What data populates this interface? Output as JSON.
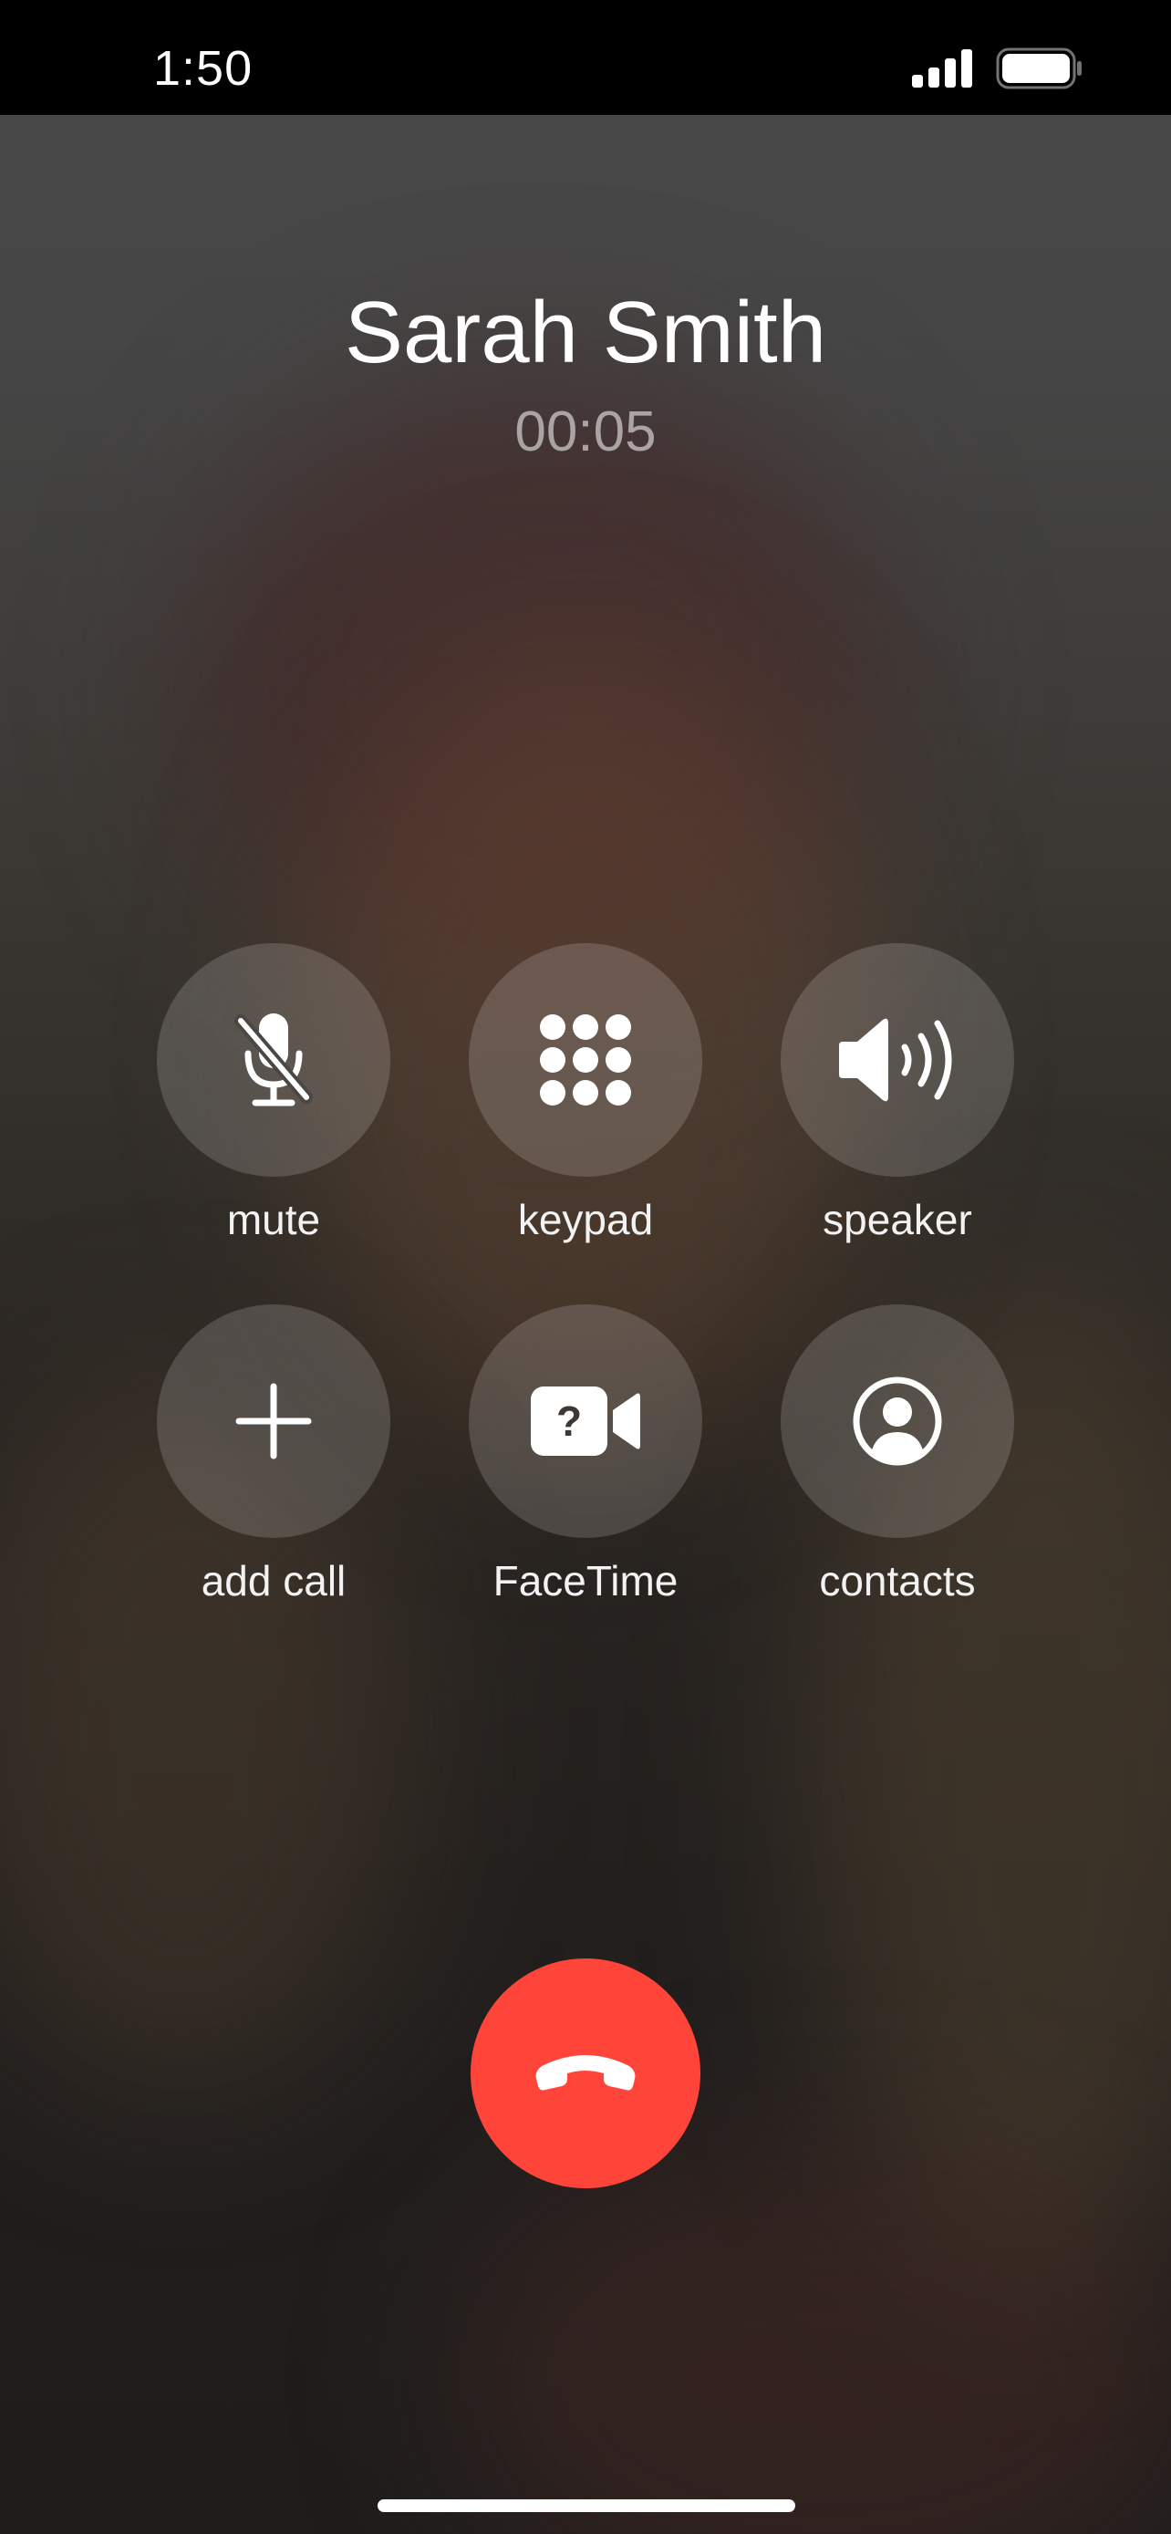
{
  "status_bar": {
    "time": "1:50"
  },
  "caller": {
    "name": "Sarah Smith",
    "timer": "00:05"
  },
  "buttons": [
    {
      "label": "mute",
      "icon": "mic-slash-icon"
    },
    {
      "label": "keypad",
      "icon": "keypad-icon"
    },
    {
      "label": "speaker",
      "icon": "speaker-wave-icon"
    },
    {
      "label": "add call",
      "icon": "plus-icon"
    },
    {
      "label": "FaceTime",
      "icon": "video-question-icon"
    },
    {
      "label": "contacts",
      "icon": "person-circle-icon"
    }
  ],
  "end_call": {
    "icon": "end-call-icon",
    "color": "#ff453a"
  }
}
